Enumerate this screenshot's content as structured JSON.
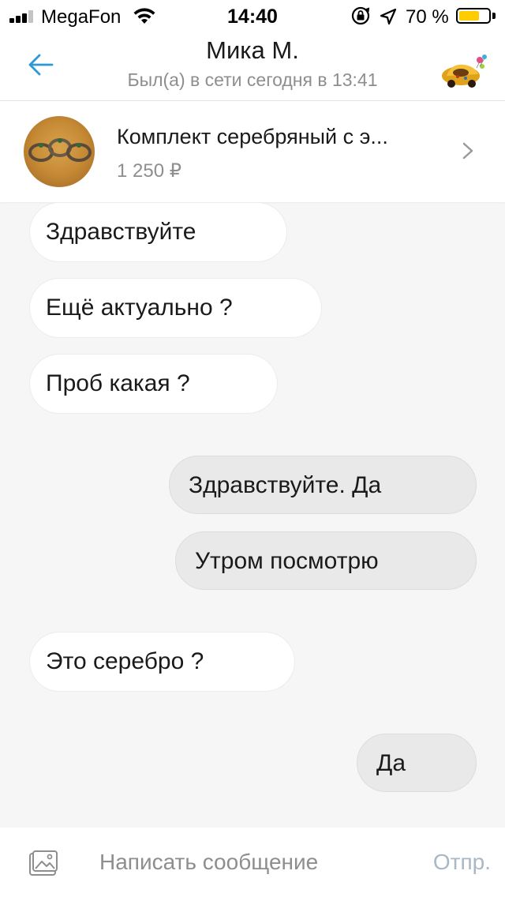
{
  "status_bar": {
    "carrier": "MegaFon",
    "time": "14:40",
    "battery_percent": "70 %",
    "battery_level": 0.7,
    "signal_bars": 3,
    "signal_bars_max": 4,
    "icons": [
      "signal-icon",
      "wifi-icon",
      "orientation-lock-icon",
      "location-icon",
      "battery-icon"
    ]
  },
  "header": {
    "contact_name": "Мика М.",
    "last_seen": "Был(а) в сети сегодня в 13:41",
    "accent_color": "#2d9ad5"
  },
  "product": {
    "title": "Комплект серебряный с э...",
    "price": "1 250 ₽"
  },
  "messages": [
    {
      "direction": "incoming",
      "text": "Здравствуйте"
    },
    {
      "direction": "incoming",
      "text": "Ещё актуально ?"
    },
    {
      "direction": "incoming",
      "text": "Проб какая ?"
    },
    {
      "direction": "outgoing",
      "text": "Здравствуйте. Да"
    },
    {
      "direction": "outgoing",
      "text": "Утром посмотрю"
    },
    {
      "direction": "incoming",
      "text": "Это серебро ?"
    },
    {
      "direction": "outgoing",
      "text": "Да"
    }
  ],
  "composer": {
    "placeholder": "Написать сообщение",
    "value": "",
    "send_label": "Отпр."
  }
}
